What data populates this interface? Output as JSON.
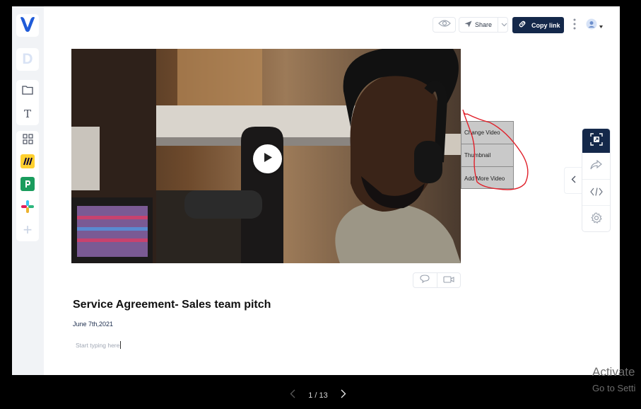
{
  "app": {
    "brand_icon": "brand-logo-icon",
    "accent_color": "#14284a"
  },
  "sidebar": {
    "workspace_initial": "D",
    "items": [
      {
        "name": "folder-icon"
      },
      {
        "name": "text-icon",
        "glyph": "T"
      },
      {
        "name": "apps-grid-icon"
      },
      {
        "name": "miro-icon"
      },
      {
        "name": "pandadoc-icon"
      },
      {
        "name": "slack-icon"
      },
      {
        "name": "add-icon",
        "glyph": "+"
      }
    ]
  },
  "topbar": {
    "share_label": "Share",
    "copy_link_label": "Copy link"
  },
  "context_menu": {
    "items": [
      "Change Video",
      "Thumbnail",
      "Add More Video"
    ]
  },
  "document": {
    "title": "Service Agreement- Sales team pitch",
    "date": "June 7th,2021",
    "body_placeholder": "Start typing here"
  },
  "pager": {
    "label": "1 / 13"
  },
  "watermark": {
    "line1": "Activate",
    "line2": "Go to Setti"
  }
}
